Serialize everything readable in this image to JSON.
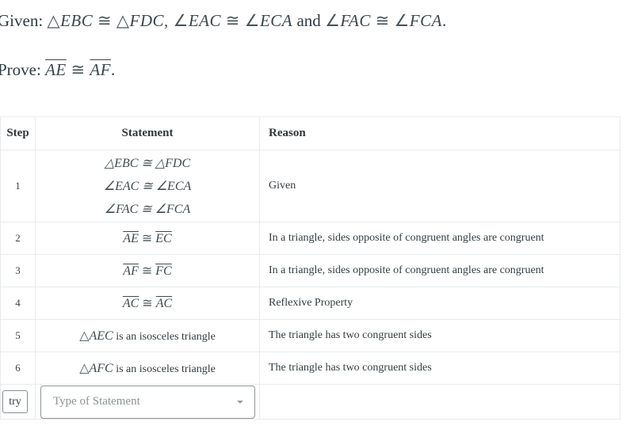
{
  "problem": {
    "given_label": "Given:",
    "given_parts": [
      {
        "sym": "△",
        "text": "EBC"
      },
      {
        "sym": " ≅ ",
        "text": ""
      },
      {
        "sym": " △",
        "text": "FDC"
      },
      {
        "sym": ", ∠",
        "text": "EAC"
      },
      {
        "sym": " ≅ ",
        "text": ""
      },
      {
        "sym": " ∠",
        "text": "ECA"
      }
    ],
    "given_and": " and ",
    "given_parts_2": [
      {
        "sym": "∠",
        "text": "FAC"
      },
      {
        "sym": " ≅ ",
        "text": ""
      },
      {
        "sym": " ∠",
        "text": "FCA"
      }
    ],
    "given_end": ".",
    "prove_label": "Prove:",
    "prove_left": "AE",
    "prove_sym": " ≅ ",
    "prove_right": "AF",
    "prove_end": "."
  },
  "table": {
    "headers": {
      "step": "Step",
      "statement": "Statement",
      "reason": "Reason"
    },
    "rows": [
      {
        "step": "1",
        "statement_lines": [
          "△EBC ≅ △FDC",
          "∠EAC ≅ ∠ECA",
          "∠FAC ≅ ∠FCA"
        ],
        "reason": "Given"
      },
      {
        "step": "2",
        "left": "AE",
        "sym": " ≅ ",
        "right": "EC",
        "reason": "In a triangle, sides opposite of congruent angles are congruent"
      },
      {
        "step": "3",
        "left": "AF",
        "sym": " ≅ ",
        "right": "FC",
        "reason": "In a triangle, sides opposite of congruent angles are congruent"
      },
      {
        "step": "4",
        "left": "AC",
        "sym": " ≅ ",
        "right": "AC",
        "reason": "Reflexive Property"
      },
      {
        "step": "5",
        "tri": "△",
        "name": "AEC",
        "rest": " is an isosceles triangle",
        "reason": "The triangle has two congruent sides"
      },
      {
        "step": "6",
        "tri": "△",
        "name": "AFC",
        "rest": " is an isosceles triangle",
        "reason": "The triangle has two congruent sides"
      }
    ],
    "input_row": {
      "try_label": "try",
      "select_placeholder": "Type of Statement"
    }
  }
}
